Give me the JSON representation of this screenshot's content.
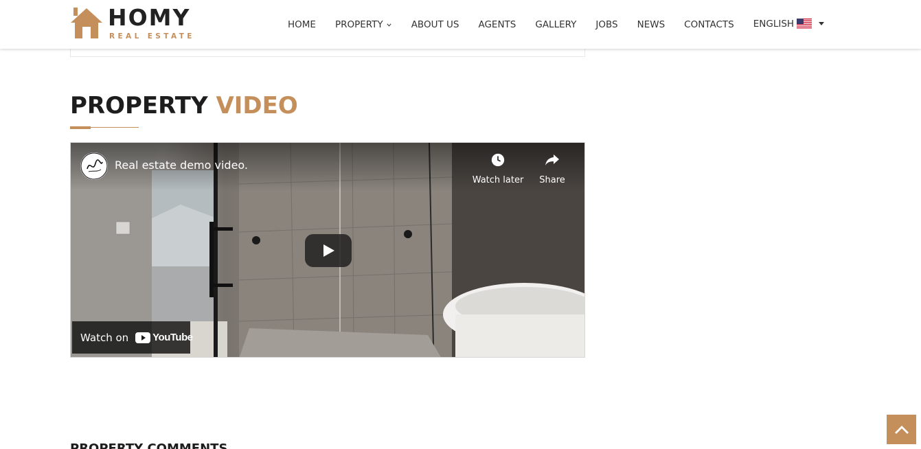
{
  "brand": {
    "name": "HOMY",
    "tagline": "REAL ESTATE",
    "accent_color": "#c58f5b"
  },
  "nav": {
    "items": [
      {
        "label": "HOME"
      },
      {
        "label": "PROPERTY",
        "has_dropdown": true
      },
      {
        "label": "ABOUT US"
      },
      {
        "label": "AGENTS"
      },
      {
        "label": "GALLERY"
      },
      {
        "label": "JOBS"
      },
      {
        "label": "NEWS"
      },
      {
        "label": "CONTACTS"
      }
    ],
    "language": {
      "label": "ENGLISH",
      "flag": "us-flag-icon"
    }
  },
  "section": {
    "title_main": "PROPERTY",
    "title_accent": "VIDEO"
  },
  "video": {
    "title": "Real estate demo video.",
    "watch_later": "Watch later",
    "share": "Share",
    "watch_on": "Watch on",
    "platform": "YouTube"
  },
  "next_section": {
    "title": "PROPERTY COMMENTS"
  },
  "icons": {
    "back_to_top": "chevron-up-icon",
    "play": "play-icon",
    "clock": "clock-icon",
    "share": "share-arrow-icon"
  }
}
